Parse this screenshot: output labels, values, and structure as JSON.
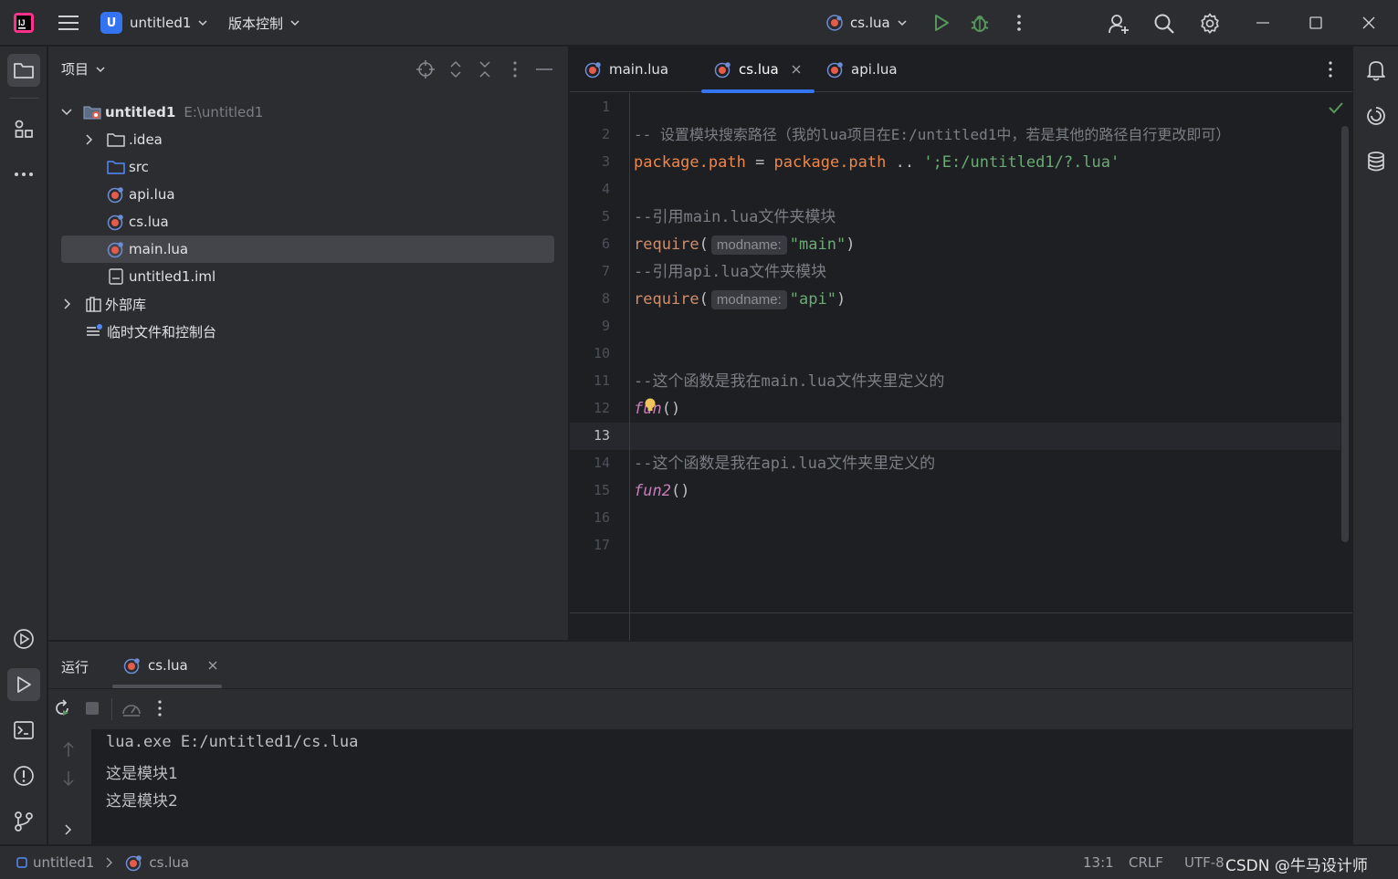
{
  "titlebar": {
    "project_badge": "U",
    "project_name": "untitled1",
    "vcs_label": "版本控制",
    "run_config": "cs.lua"
  },
  "project_panel": {
    "title": "项目",
    "tree": [
      {
        "label": "untitled1",
        "path": "E:\\untitled1"
      },
      {
        "label": ".idea"
      },
      {
        "label": "src"
      },
      {
        "label": "api.lua"
      },
      {
        "label": "cs.lua"
      },
      {
        "label": "main.lua"
      },
      {
        "label": "untitled1.iml"
      },
      {
        "label": "外部库"
      },
      {
        "label": "临时文件和控制台"
      }
    ]
  },
  "editor": {
    "tabs": [
      {
        "label": "main.lua"
      },
      {
        "label": "cs.lua",
        "active": true
      },
      {
        "label": "api.lua"
      }
    ],
    "line_numbers": [
      "1",
      "2",
      "3",
      "4",
      "5",
      "6",
      "7",
      "8",
      "9",
      "10",
      "11",
      "12",
      "13",
      "14",
      "15",
      "16",
      "17"
    ],
    "current_line": "13",
    "lines": {
      "l2": "-- 设置模块搜索路径（我的lua项目在E:/untitled1中，若是其他的路径自行更改即可）",
      "l3_a": "package.path",
      "l3_b": " = ",
      "l3_c": "package.path",
      "l3_d": " .. ",
      "l3_e": "';E:/untitled1/?.lua'",
      "l5": "--引用main.lua文件夹模块",
      "l6_fn": "require",
      "l6_hint": "modname:",
      "l6_str": "\"main\"",
      "l7": "--引用api.lua文件夹模块",
      "l8_fn": "require",
      "l8_hint": "modname:",
      "l8_str": "\"api\"",
      "l11": "--这个函数是我在main.lua文件夹里定义的",
      "l12": "fun",
      "l14": "--这个函数是我在api.lua文件夹里定义的",
      "l15": "fun2"
    }
  },
  "run_panel": {
    "title": "运行",
    "tab": "cs.lua",
    "output": [
      "lua.exe E:/untitled1/cs.lua",
      "这是模块1",
      "这是模块2"
    ]
  },
  "statusbar": {
    "crumb_project": "untitled1",
    "crumb_file": "cs.lua",
    "position": "13:1",
    "line_sep": "CRLF",
    "encoding": "UTF-8",
    "watermark": "CSDN @牛马设计师"
  }
}
